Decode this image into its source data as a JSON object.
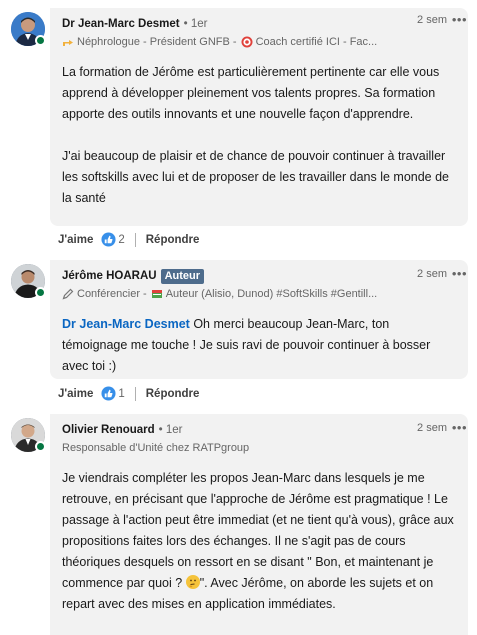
{
  "comments": [
    {
      "name": "Dr Jean-Marc Desmet",
      "degree": "• 1er",
      "headline_part1": "Néphrologue - Président GNFB -",
      "headline_part2": "Coach certifié ICI - Fac...",
      "time": "2 sem",
      "more": "•••",
      "paragraphs": [
        "La formation de Jérôme est particulièrement pertinente car elle vous apprend à développer pleinement vos talents propres. Sa formation apporte des outils innovants et une nouvelle façon d'apprendre.",
        "J'ai beaucoup de plaisir et de chance de pouvoir continuer à travailler les softskills avec lui et de proposer de les travailler dans le monde de la santé"
      ],
      "like_label": "J'aime",
      "reaction_count": "2",
      "reply_label": "Répondre"
    },
    {
      "name": "Jérôme HOARAU",
      "author_badge": "Auteur",
      "headline_part1": "Conférencier -",
      "headline_part2": "Auteur (Alisio, Dunod) #SoftSkills #Gentill...",
      "time": "2 sem",
      "more": "•••",
      "mention": "Dr Jean-Marc Desmet",
      "reply_text": " Oh merci beaucoup Jean-Marc, ton témoignage me touche ! Je suis ravi de pouvoir continuer à bosser avec toi :)",
      "like_label": "J'aime",
      "reaction_count": "1",
      "reply_label": "Répondre"
    },
    {
      "name": "Olivier Renouard",
      "degree": "• 1er",
      "headline": "Responsable d'Unité chez RATPgroup",
      "time": "2 sem",
      "more": "•••",
      "text_before_emoji": "Je viendrais compléter les propos Jean-Marc dans lesquels je me retrouve, en précisant que l'approche de Jérôme est pragmatique ! Le passage à l'action peut être immediat (et ne tient qu'à vous), grâce aux propositions faites lors des échanges. Il ne s'agit pas de cours théoriques desquels on ressort en se disant \" Bon, et maintenant je commence par quoi ? ",
      "text_after_emoji": "\". Avec Jérôme, on aborde les sujets et on repart avec des mises en application immédiates."
    }
  ],
  "colors": {
    "bubble": "#f2f2f2",
    "link": "#0a66c2",
    "presence": "#057642",
    "author_badge": "#4e6c8c"
  },
  "icons": {
    "pointing": "hand-pointing-icon",
    "target": "target-icon",
    "pencil": "pencil-icon",
    "book": "book-icon",
    "like_reaction": "like-reaction-icon",
    "thinking": "thinking-emoji-icon"
  }
}
